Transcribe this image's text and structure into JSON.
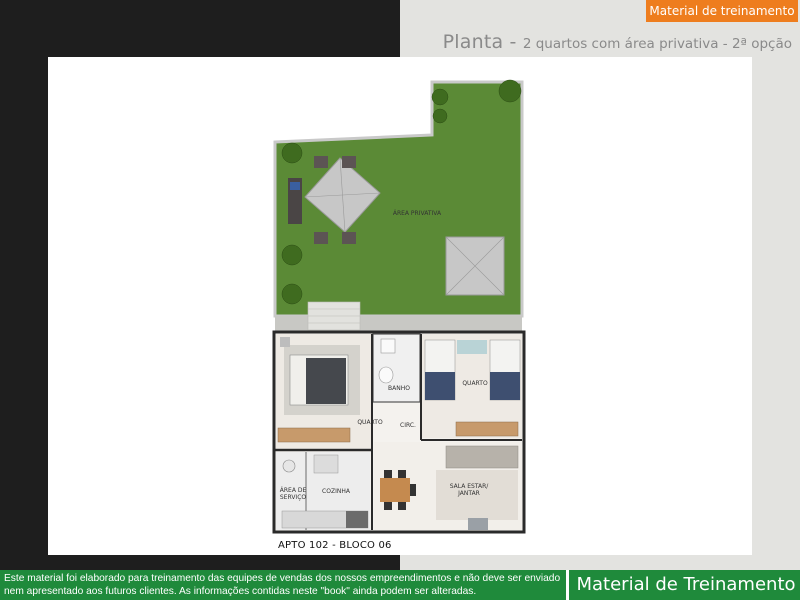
{
  "header": {
    "badge": "Material de treinamento",
    "title_main": "Planta - ",
    "title_sub": "2 quartos com área privativa - 2ª opção"
  },
  "floor_plan": {
    "rooms": {
      "garden": "ÁREA PRIVATIVA",
      "bathroom": "BANHO",
      "bedroom1": "QUARTO",
      "bedroom2": "QUARTO",
      "circulation": "CIRC.",
      "service": "ÁREA DE SERVIÇO",
      "kitchen": "COZINHA",
      "living": "SALA ESTAR/ JANTAR"
    },
    "unit_label": "APTO 102 - BLOCO 06"
  },
  "footer": {
    "disclaimer": "Este material foi elaborado para treinamento das equipes de vendas dos nossos empreendimentos e não deve ser enviado nem apresentado aos futuros clientes. As informações contidas neste \"book\" ainda podem ser alteradas.",
    "brand": "Material de Treinamento"
  },
  "colors": {
    "badge_orange": "#ee7d1e",
    "footer_green": "#1f8a3b",
    "grass_green": "#5b8a36"
  }
}
